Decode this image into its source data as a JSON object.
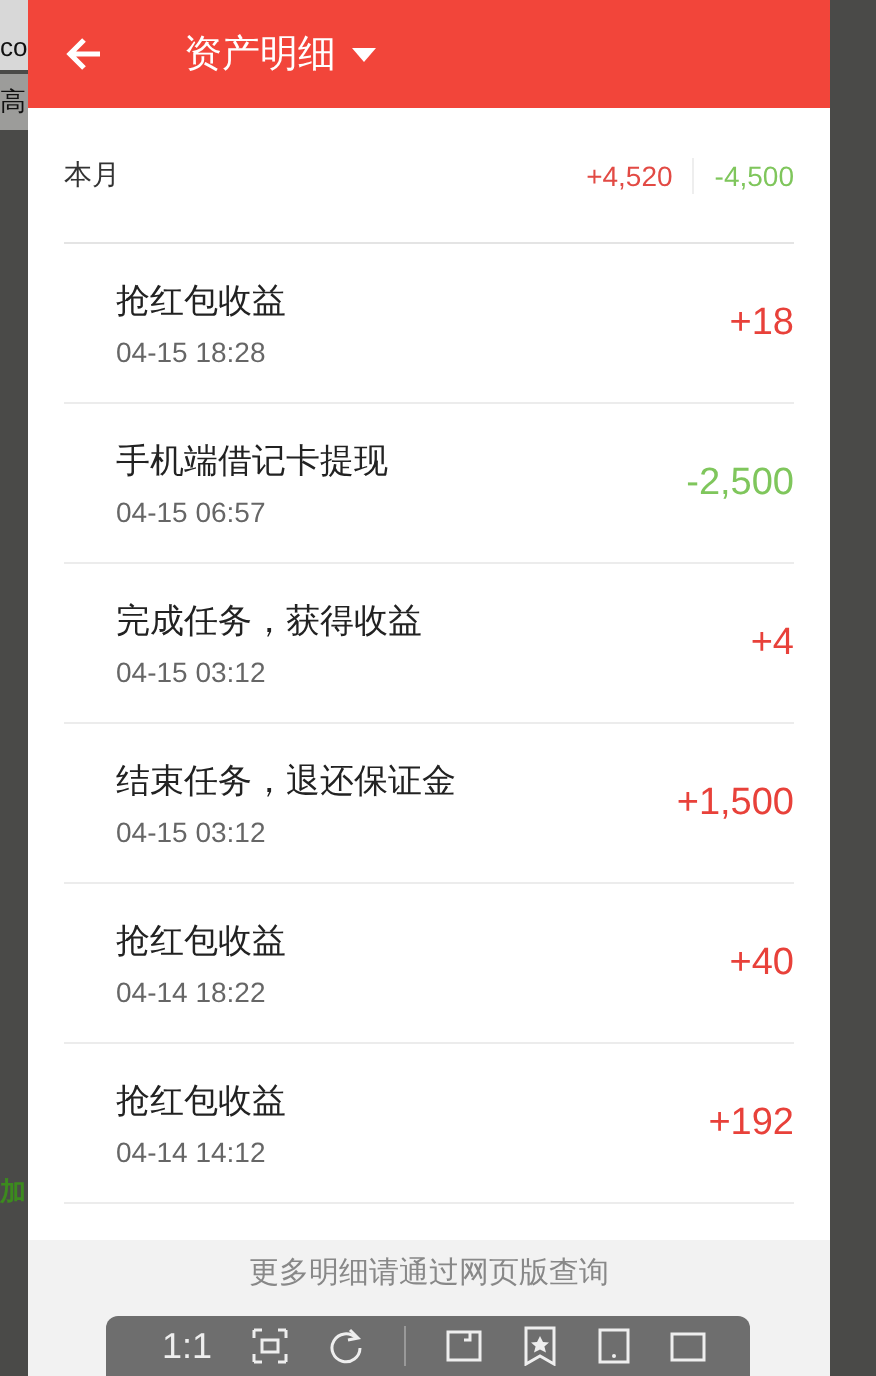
{
  "background_page": {
    "left_fragments": [
      {
        "text": "co",
        "kind": "top"
      },
      {
        "text": "高",
        "kind": "tab"
      },
      {
        "text": "加",
        "kind": "link"
      }
    ]
  },
  "header": {
    "title": "资产明细"
  },
  "summary": {
    "label": "本月",
    "income": "+4,520",
    "expense": "-4,500"
  },
  "records": [
    {
      "title": "抢红包收益",
      "time": "04-15 18:28",
      "amount": "+18",
      "kind": "income"
    },
    {
      "title": "手机端借记卡提现",
      "time": "04-15 06:57",
      "amount": "-2,500",
      "kind": "expense"
    },
    {
      "title": "完成任务，获得收益",
      "time": "04-15 03:12",
      "amount": "+4",
      "kind": "income"
    },
    {
      "title": "结束任务，退还保证金",
      "time": "04-15 03:12",
      "amount": "+1,500",
      "kind": "income"
    },
    {
      "title": "抢红包收益",
      "time": "04-14 18:22",
      "amount": "+40",
      "kind": "income"
    },
    {
      "title": "抢红包收益",
      "time": "04-14 14:12",
      "amount": "+192",
      "kind": "income"
    }
  ],
  "footer": {
    "text": "更多明细请通过网页版查询"
  },
  "viewer_toolbar": {
    "zoom_label": "1:1"
  }
}
